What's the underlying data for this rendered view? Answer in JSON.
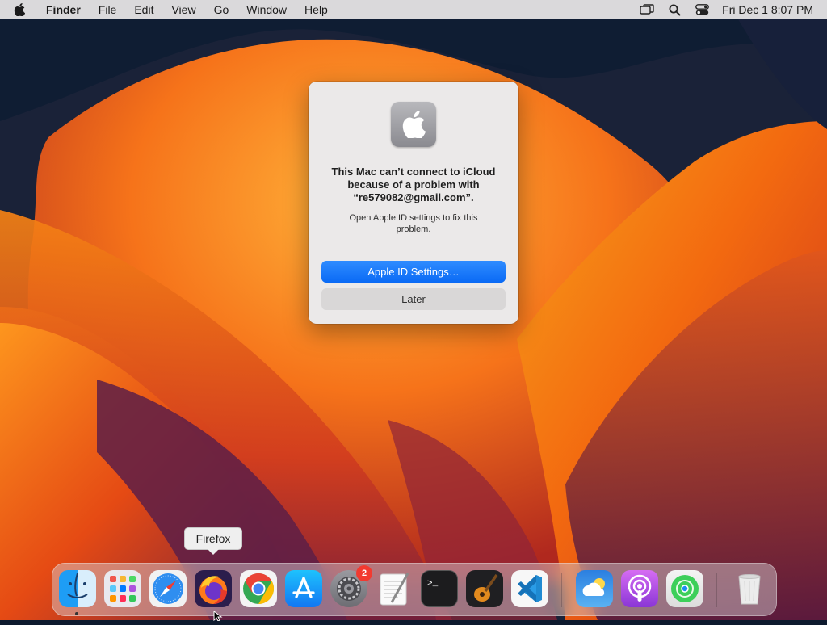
{
  "menubar": {
    "app_name": "Finder",
    "items": [
      "File",
      "Edit",
      "View",
      "Go",
      "Window",
      "Help"
    ],
    "clock": "Fri Dec 1  8:07 PM",
    "status_icons": [
      "screen-mirroring-icon",
      "spotlight-search-icon",
      "control-center-icon"
    ]
  },
  "dialog": {
    "icon": "system-settings-apple-icon",
    "title": "This Mac can’t connect to iCloud because of a problem with “re579082@gmail.com”.",
    "message": "Open Apple ID settings to fix this problem.",
    "primary_button": "Apple ID Settings…",
    "secondary_button": "Later"
  },
  "tooltip": {
    "label": "Firefox"
  },
  "dock": {
    "apps": [
      {
        "name": "Finder",
        "icon": "finder-icon",
        "running": true
      },
      {
        "name": "Launchpad",
        "icon": "launchpad-icon"
      },
      {
        "name": "Safari",
        "icon": "safari-icon"
      },
      {
        "name": "Firefox",
        "icon": "firefox-icon"
      },
      {
        "name": "Chrome",
        "icon": "chrome-icon"
      },
      {
        "name": "App Store",
        "icon": "app-store-icon"
      },
      {
        "name": "System Settings",
        "icon": "system-settings-icon",
        "badge": "2"
      },
      {
        "name": "TextEdit",
        "icon": "textedit-icon"
      },
      {
        "name": "Terminal",
        "icon": "terminal-icon"
      },
      {
        "name": "GarageBand",
        "icon": "garageband-icon"
      },
      {
        "name": "VS Code",
        "icon": "vscode-icon"
      },
      {
        "name": "Weather",
        "icon": "weather-icon"
      },
      {
        "name": "Podcasts",
        "icon": "podcasts-icon"
      },
      {
        "name": "Find My",
        "icon": "find-my-icon"
      },
      {
        "name": "Trash",
        "icon": "trash-icon"
      }
    ]
  },
  "colors": {
    "accent": "#0a6af5",
    "badge": "#f23a30"
  }
}
